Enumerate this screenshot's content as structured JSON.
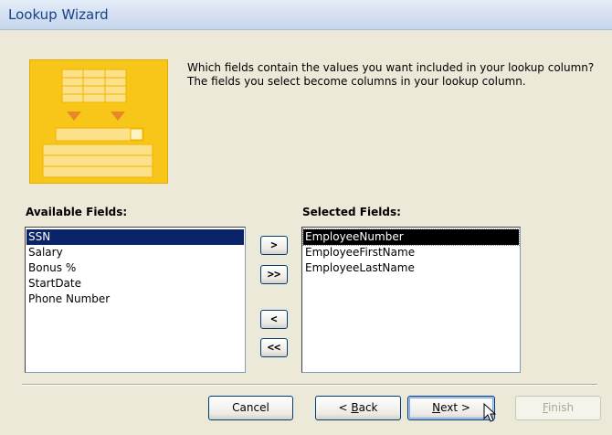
{
  "window": {
    "title": "Lookup Wizard"
  },
  "prompt": "Which fields contain the values you want included in your lookup column? The fields you select become columns in your lookup column.",
  "available": {
    "label": "Available Fields:",
    "items": [
      "SSN",
      "Salary",
      "Bonus %",
      "StartDate",
      "Phone Number"
    ],
    "selected_index": 0
  },
  "selected": {
    "label": "Selected Fields:",
    "items": [
      "EmployeeNumber",
      "EmployeeFirstName",
      "EmployeeLastName"
    ],
    "selected_index": 0
  },
  "move_buttons": {
    "add_one": ">",
    "add_all": ">>",
    "remove_one": "<",
    "remove_all": "<<"
  },
  "footer": {
    "cancel": "Cancel",
    "back_underlined": "B",
    "back_prefix": "< ",
    "back_rest": "ack",
    "next_underlined": "N",
    "next_rest": "ext >",
    "finish_underlined": "F",
    "finish_rest": "inish"
  },
  "colors": {
    "accent": "#f8c619",
    "title_text": "#15428b",
    "selection": "#0a246a"
  }
}
